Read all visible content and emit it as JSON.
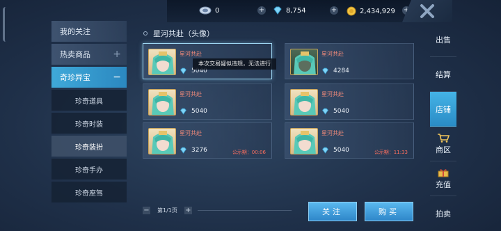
{
  "top": {
    "coupon_amount": "0",
    "diamond_amount": "8,754",
    "gold_amount": "2,434,929",
    "add": "+"
  },
  "sidebar": {
    "items": [
      {
        "label": "我的关注",
        "sign": ""
      },
      {
        "label": "热卖商品",
        "sign": "+"
      },
      {
        "label": "奇珍异宝",
        "sign": "−"
      }
    ],
    "subitems": [
      {
        "label": "珍奇道具"
      },
      {
        "label": "珍奇时装"
      },
      {
        "label": "珍奇装扮"
      },
      {
        "label": "珍奇手办"
      },
      {
        "label": "珍奇座驾"
      }
    ]
  },
  "section": {
    "title": "星河共赴（头像）"
  },
  "items": [
    {
      "name": "星河共赴",
      "price": "5040",
      "announce": ""
    },
    {
      "name": "星河共赴",
      "price": "4284",
      "announce": ""
    },
    {
      "name": "星河共赴",
      "price": "5040",
      "announce": ""
    },
    {
      "name": "星河共赴",
      "price": "5040",
      "announce": ""
    },
    {
      "name": "星河共赴",
      "price": "3276",
      "announce": "公示期：00:06"
    },
    {
      "name": "星河共赴",
      "price": "5040",
      "announce": "公示期：11:33"
    }
  ],
  "tooltip": "本次交易疑似违规，无法进行",
  "pager": {
    "minus": "−",
    "plus": "+",
    "text": "第1/1页"
  },
  "buttons": {
    "follow": "关注",
    "buy": "购买"
  },
  "rightnav": {
    "sell": "出售",
    "settle": "结算",
    "shop": "店铺",
    "mall": "商区",
    "recharge": "充值",
    "auction": "拍卖"
  },
  "colors": {
    "accent": "#3fa9d9",
    "price_red": "#f08a7a",
    "announce_red": "#ff6f5e"
  }
}
